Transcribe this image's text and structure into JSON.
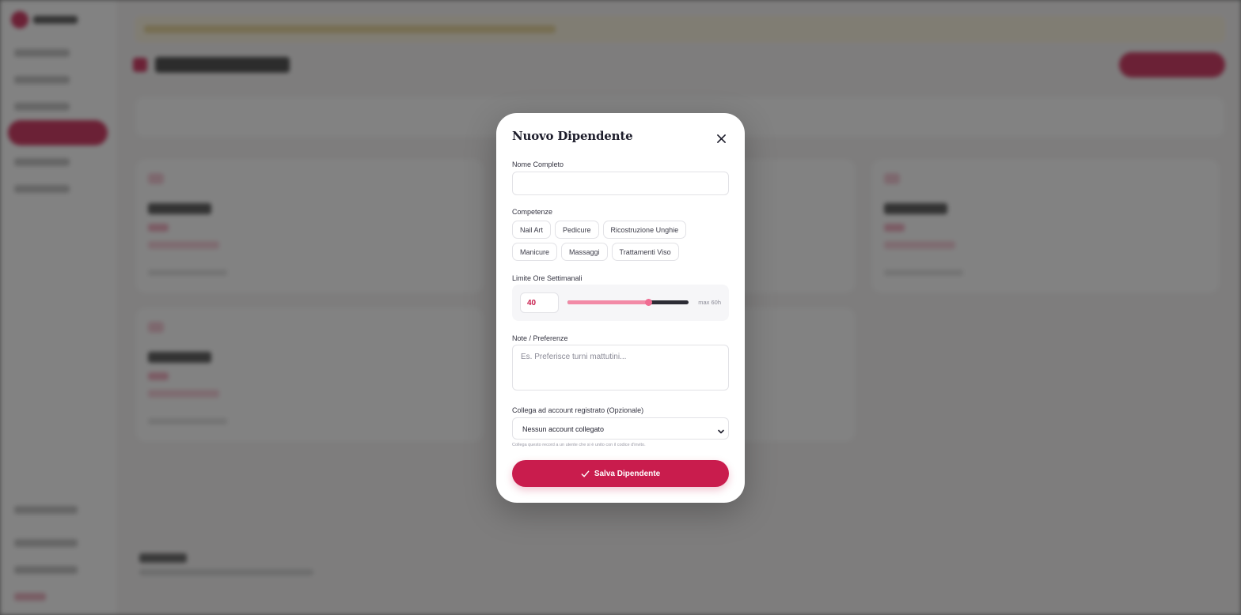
{
  "modal": {
    "title": "Nuovo Dipendente",
    "close_icon": "close-icon",
    "name_label": "Nome Completo",
    "name_value": "",
    "skills_label": "Competenze",
    "skills_row1": [
      "Nail Art",
      "Pedicure",
      "Ricostruzione Unghie"
    ],
    "skills_row2": [
      "Manicure",
      "Massaggi",
      "Trattamenti Viso"
    ],
    "hours_label": "Limite Ore Settimanali",
    "hours_value": "40",
    "hours_max_text": "max 60h",
    "hours_fraction": 0.667,
    "notes_label": "Note / Preferenze",
    "notes_placeholder": "Es. Preferisce turni mattutini...",
    "account_label": "Collega ad account registrato (Opzionale)",
    "account_selected": "Nessun account collegato",
    "account_hint": "Collega questo record a un utente che si è unito con il codice d'invito.",
    "save_label": "Salva Dipendente",
    "save_icon": "check-icon"
  },
  "colors": {
    "accent": "#c91c4d",
    "slider_fill": "#f28aa6",
    "overlay": "rgba(40,40,40,0.58)"
  }
}
